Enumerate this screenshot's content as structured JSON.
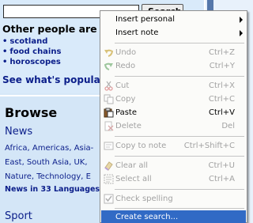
{
  "search": {
    "input_value": "",
    "button_label": "Search",
    "others_heading": "Other people are s",
    "links": [
      "scotland",
      "food chains",
      "horoscopes"
    ],
    "popular_link": "See what's popular"
  },
  "browse": {
    "heading": "Browse",
    "news_heading": "News",
    "news_lines": [
      "Africa, Americas, Asia-",
      "East, South Asia, UK,",
      "Nature, Technology, E"
    ],
    "news_languages": "News in 33 Languages.",
    "sport_heading": "Sport"
  },
  "menu": {
    "insert_personal": "Insert personal",
    "insert_note": "Insert note",
    "undo": {
      "label": "Undo",
      "shortcut": "Ctrl+Z"
    },
    "redo": {
      "label": "Redo",
      "shortcut": "Ctrl+Y"
    },
    "cut": {
      "label": "Cut",
      "shortcut": "Ctrl+X"
    },
    "copy": {
      "label": "Copy",
      "shortcut": "Ctrl+C"
    },
    "paste": {
      "label": "Paste",
      "shortcut": "Ctrl+V"
    },
    "delete": {
      "label": "Delete",
      "shortcut": "Del"
    },
    "copy_to_note": {
      "label": "Copy to note",
      "shortcut": "Ctrl+Shift+C"
    },
    "clear_all": {
      "label": "Clear all",
      "shortcut": "Ctrl+U"
    },
    "select_all": {
      "label": "Select all",
      "shortcut": "Ctrl+A"
    },
    "check_spelling": {
      "label": "Check spelling"
    },
    "create_search": {
      "label": "Create search..."
    }
  },
  "colors": {
    "highlight": "#316ac5",
    "disabled_text": "#a2a2a2",
    "link": "#0b1e8a"
  }
}
